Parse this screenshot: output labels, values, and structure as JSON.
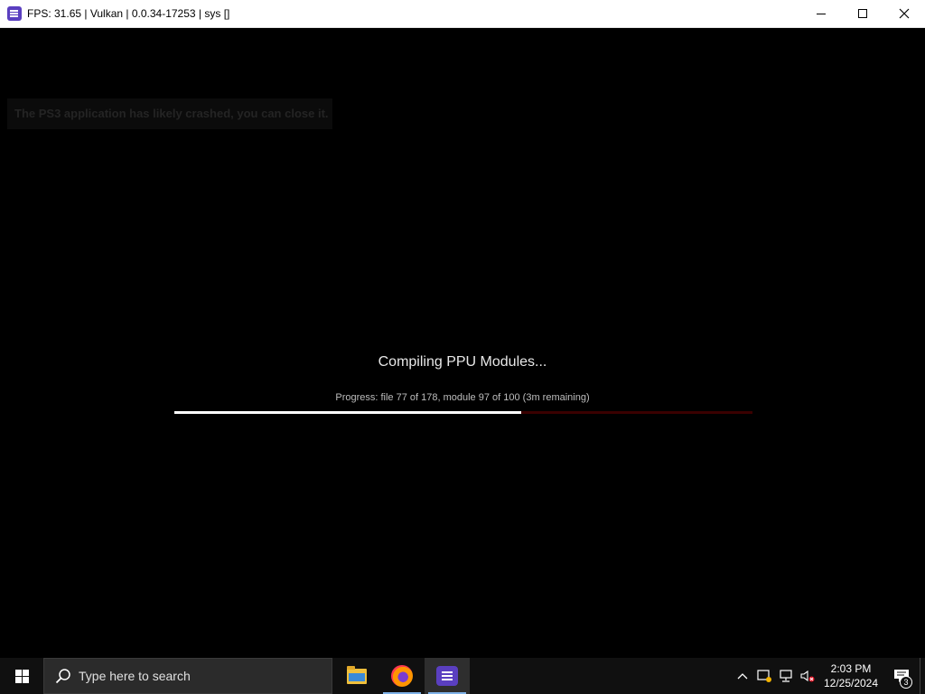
{
  "window": {
    "title": "FPS: 31.65 | Vulkan | 0.0.34-17253 | sys []",
    "app_icon": "rpcs3-icon",
    "controls": [
      "minimize",
      "maximize",
      "close"
    ]
  },
  "game": {
    "notice": "The PS3 application has likely crashed, you can close it.",
    "compile_title": "Compiling PPU Modules...",
    "progress_text": "Progress: file 77 of 178, module 97 of 100 (3m remaining)",
    "progress_fraction": 0.6,
    "progress_color": "#ffffff",
    "track_color": "#3a0000"
  },
  "taskbar": {
    "search_placeholder": "Type here to search",
    "apps": [
      {
        "name": "file-explorer",
        "running": false
      },
      {
        "name": "firefox",
        "running": true
      },
      {
        "name": "rpcs3",
        "running": true,
        "active": true
      }
    ],
    "clock": {
      "time": "2:03 PM",
      "date": "12/25/2024"
    },
    "notification_count": "3"
  }
}
